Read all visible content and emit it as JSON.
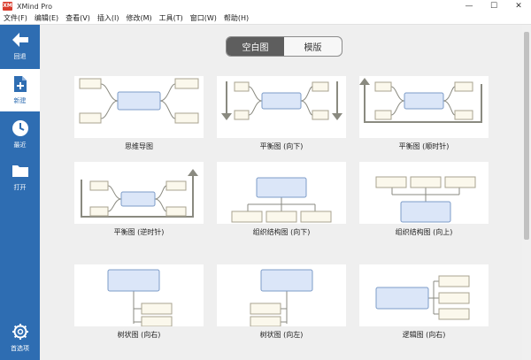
{
  "window": {
    "logo": "XM",
    "title": "XMind Pro",
    "minimize": "—",
    "maximize": "☐",
    "close": "✕"
  },
  "menu": [
    "文件(F)",
    "编辑(E)",
    "查看(V)",
    "插入(I)",
    "修改(M)",
    "工具(T)",
    "窗口(W)",
    "帮助(H)"
  ],
  "sidebar": {
    "items": [
      {
        "label": "回退",
        "icon": "arrow-left-icon"
      },
      {
        "label": "新建",
        "icon": "new-file-icon"
      },
      {
        "label": "最近",
        "icon": "clock-icon"
      },
      {
        "label": "打开",
        "icon": "folder-icon"
      },
      {
        "label": "首选项",
        "icon": "gear-icon"
      }
    ]
  },
  "tabs": {
    "blank": "空白图",
    "template": "模版"
  },
  "templates": [
    {
      "name": "思维导图"
    },
    {
      "name": "平衡图 (向下)"
    },
    {
      "name": "平衡图 (顺时针)"
    },
    {
      "name": "平衡图 (逆时针)"
    },
    {
      "name": "组织结构图 (向下)"
    },
    {
      "name": "组织结构图 (向上)"
    },
    {
      "name": "树状图 (向右)"
    },
    {
      "name": "树状图 (向左)"
    },
    {
      "name": "逻辑图 (向右)"
    }
  ],
  "colors": {
    "sidebar": "#2e6db2",
    "central_fill": "#dbe6f8",
    "central_stroke": "#7d9cc8",
    "topic_fill": "#fbf8ec",
    "topic_stroke": "#a8a390",
    "line": "#8a8a80"
  }
}
